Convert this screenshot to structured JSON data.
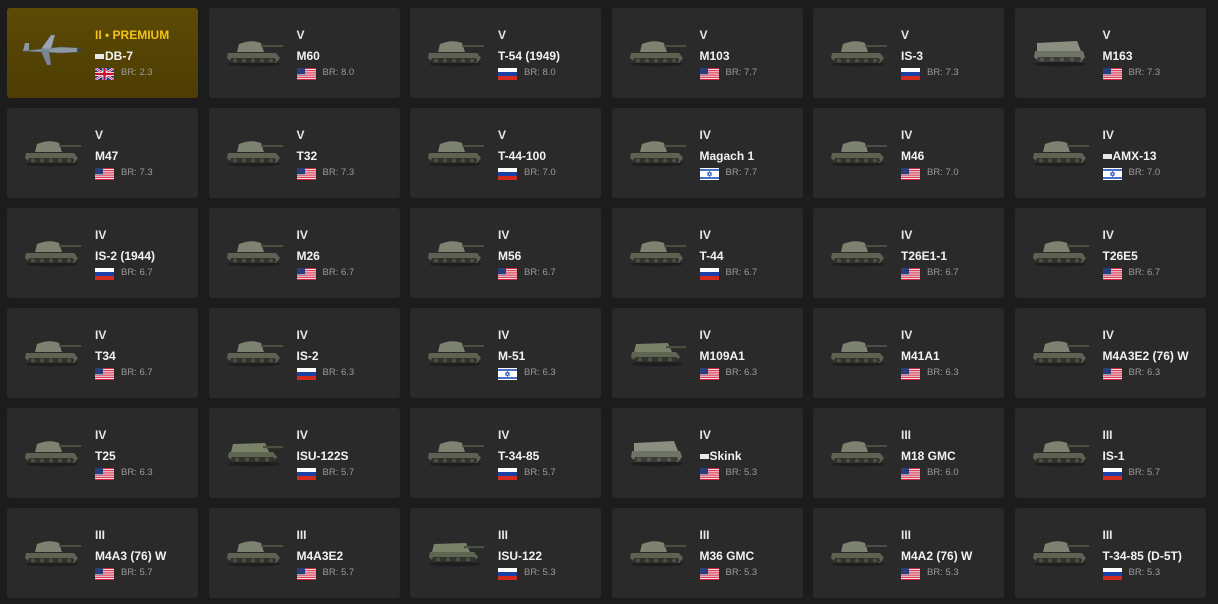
{
  "cards": [
    {
      "tier": "II • PREMIUM",
      "name": "DB-7",
      "nation": "uk",
      "br": "BR: 2.3",
      "icon": "plane-icon",
      "premium": true,
      "mark": true
    },
    {
      "tier": "V",
      "name": "M60",
      "nation": "usa",
      "br": "BR: 8.0",
      "icon": "tank-icon"
    },
    {
      "tier": "V",
      "name": "T-54 (1949)",
      "nation": "ussr",
      "br": "BR: 8.0",
      "icon": "tank-icon"
    },
    {
      "tier": "V",
      "name": "M103",
      "nation": "usa",
      "br": "BR: 7.7",
      "icon": "tank-icon"
    },
    {
      "tier": "V",
      "name": "IS-3",
      "nation": "ussr",
      "br": "BR: 7.3",
      "icon": "tank-icon"
    },
    {
      "tier": "V",
      "name": "M163",
      "nation": "usa",
      "br": "BR: 7.3",
      "icon": "spaa-icon"
    },
    {
      "tier": "V",
      "name": "M47",
      "nation": "usa",
      "br": "BR: 7.3",
      "icon": "tank-icon"
    },
    {
      "tier": "V",
      "name": "T32",
      "nation": "usa",
      "br": "BR: 7.3",
      "icon": "tank-icon"
    },
    {
      "tier": "V",
      "name": "T-44-100",
      "nation": "ussr",
      "br": "BR: 7.0",
      "icon": "tank-icon"
    },
    {
      "tier": "IV",
      "name": "Magach 1",
      "nation": "israel",
      "br": "BR: 7.7",
      "icon": "tank-icon"
    },
    {
      "tier": "IV",
      "name": "M46",
      "nation": "usa",
      "br": "BR: 7.0",
      "icon": "tank-icon"
    },
    {
      "tier": "IV",
      "name": "AMX-13",
      "nation": "israel",
      "br": "BR: 7.0",
      "icon": "tank-icon",
      "mark": true
    },
    {
      "tier": "IV",
      "name": "IS-2 (1944)",
      "nation": "ussr",
      "br": "BR: 6.7",
      "icon": "tank-icon"
    },
    {
      "tier": "IV",
      "name": "M26",
      "nation": "usa",
      "br": "BR: 6.7",
      "icon": "tank-icon"
    },
    {
      "tier": "IV",
      "name": "M56",
      "nation": "usa",
      "br": "BR: 6.7",
      "icon": "tank-icon"
    },
    {
      "tier": "IV",
      "name": "T-44",
      "nation": "ussr",
      "br": "BR: 6.7",
      "icon": "tank-icon"
    },
    {
      "tier": "IV",
      "name": "T26E1-1",
      "nation": "usa",
      "br": "BR: 6.7",
      "icon": "tank-icon"
    },
    {
      "tier": "IV",
      "name": "T26E5",
      "nation": "usa",
      "br": "BR: 6.7",
      "icon": "tank-icon"
    },
    {
      "tier": "IV",
      "name": "T34",
      "nation": "usa",
      "br": "BR: 6.7",
      "icon": "tank-icon"
    },
    {
      "tier": "IV",
      "name": "IS-2",
      "nation": "ussr",
      "br": "BR: 6.3",
      "icon": "tank-icon"
    },
    {
      "tier": "IV",
      "name": "M-51",
      "nation": "israel",
      "br": "BR: 6.3",
      "icon": "tank-icon"
    },
    {
      "tier": "IV",
      "name": "M109A1",
      "nation": "usa",
      "br": "BR: 6.3",
      "icon": "spg-icon"
    },
    {
      "tier": "IV",
      "name": "M41A1",
      "nation": "usa",
      "br": "BR: 6.3",
      "icon": "tank-icon"
    },
    {
      "tier": "IV",
      "name": "M4A3E2 (76) W",
      "nation": "usa",
      "br": "BR: 6.3",
      "icon": "tank-icon"
    },
    {
      "tier": "IV",
      "name": "T25",
      "nation": "usa",
      "br": "BR: 6.3",
      "icon": "tank-icon"
    },
    {
      "tier": "IV",
      "name": "ISU-122S",
      "nation": "ussr",
      "br": "BR: 5.7",
      "icon": "spg-icon"
    },
    {
      "tier": "IV",
      "name": "T-34-85",
      "nation": "ussr",
      "br": "BR: 5.7",
      "icon": "tank-icon"
    },
    {
      "tier": "IV",
      "name": "Skink",
      "nation": "usa",
      "br": "BR: 5.3",
      "icon": "spaa-icon",
      "mark": true
    },
    {
      "tier": "III",
      "name": "M18 GMC",
      "nation": "usa",
      "br": "BR: 6.0",
      "icon": "tank-icon"
    },
    {
      "tier": "III",
      "name": "IS-1",
      "nation": "ussr",
      "br": "BR: 5.7",
      "icon": "tank-icon"
    },
    {
      "tier": "III",
      "name": "M4A3 (76) W",
      "nation": "usa",
      "br": "BR: 5.7",
      "icon": "tank-icon"
    },
    {
      "tier": "III",
      "name": "M4A3E2",
      "nation": "usa",
      "br": "BR: 5.7",
      "icon": "tank-icon"
    },
    {
      "tier": "III",
      "name": "ISU-122",
      "nation": "ussr",
      "br": "BR: 5.3",
      "icon": "spg-icon"
    },
    {
      "tier": "III",
      "name": "M36 GMC",
      "nation": "usa",
      "br": "BR: 5.3",
      "icon": "tank-icon"
    },
    {
      "tier": "III",
      "name": "M4A2 (76) W",
      "nation": "usa",
      "br": "BR: 5.3",
      "icon": "tank-icon"
    },
    {
      "tier": "III",
      "name": "T-34-85 (D-5T)",
      "nation": "ussr",
      "br": "BR: 5.3",
      "icon": "tank-icon"
    }
  ],
  "colors": {
    "background": "#1c1c1c",
    "card": "#2a2a2a",
    "premium_card": "#4d3d03",
    "premium_text": "#f2c21a",
    "br_text": "#9a9a9a"
  }
}
